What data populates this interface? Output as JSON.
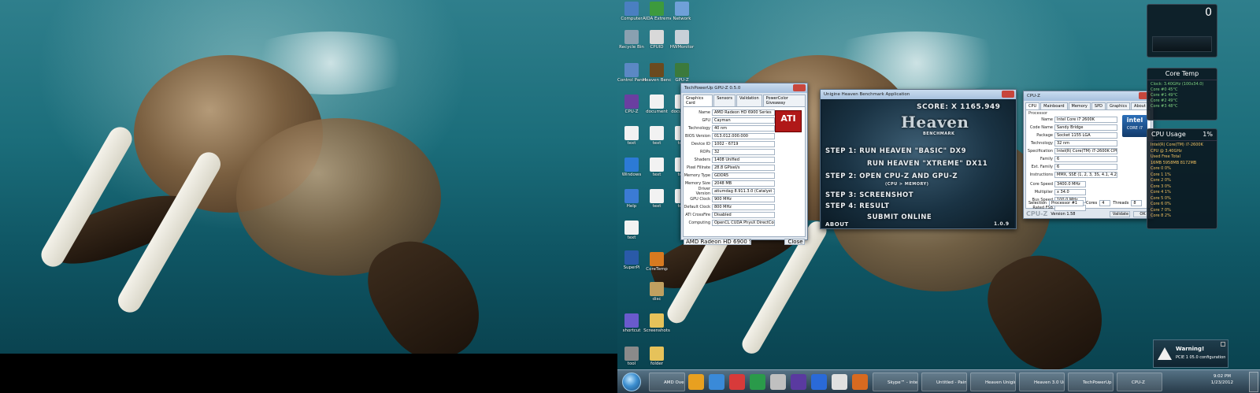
{
  "left_monitor": {},
  "desktop_icons": [
    {
      "label": "Computer",
      "color": "#4a7fc1"
    },
    {
      "label": "AIDA Extreme",
      "color": "#3d9a3d"
    },
    {
      "label": "Network",
      "color": "#6fa0d8"
    },
    {
      "label": "Recycle Bin",
      "color": "#8aa0b0"
    },
    {
      "label": "CPUID",
      "color": "#d9d9d9"
    },
    {
      "label": "HWMonitor",
      "color": "#c8d0d8"
    },
    {
      "label": "Control Panel",
      "color": "#5b88c4"
    },
    {
      "label": "Heaven Benchmark",
      "color": "#6b4a1e"
    },
    {
      "label": "GPU-Z",
      "color": "#3c7a3c"
    },
    {
      "label": "CPU-Z",
      "color": "#6a3fa0"
    },
    {
      "label": "document",
      "color": "#f2f2f2"
    },
    {
      "label": "document",
      "color": "#f2f2f2"
    },
    {
      "label": "text",
      "color": "#f2f2f2"
    },
    {
      "label": "text",
      "color": "#f2f2f2"
    },
    {
      "label": "text",
      "color": "#f2f2f2"
    },
    {
      "label": "Windows",
      "color": "#2c7ad6"
    },
    {
      "label": "text",
      "color": "#f2f2f2"
    },
    {
      "label": "text",
      "color": "#f2f2f2"
    },
    {
      "label": "Help",
      "color": "#3b7bd4"
    },
    {
      "label": "text",
      "color": "#f2f2f2"
    },
    {
      "label": "text",
      "color": "#f2f2f2"
    },
    {
      "label": "text",
      "color": "#f2f2f2"
    },
    {
      "label": "CoreTemp",
      "color": "#d87a20"
    },
    {
      "label": "SuperPi",
      "color": "#2a5aa8"
    },
    {
      "label": "disc",
      "color": "#c0a060"
    },
    {
      "label": "shortcut",
      "color": "#6a5acd"
    },
    {
      "label": "Screenshots",
      "color": "#e6c25a"
    },
    {
      "label": "tool",
      "color": "#8a8a8a"
    },
    {
      "label": "folder",
      "color": "#e6c25a"
    }
  ],
  "gpuz": {
    "title": "TechPowerUp GPU-Z 0.5.0",
    "tabs": [
      "Graphics Card",
      "Sensors",
      "Validation",
      "PowerColor Giveaway"
    ],
    "rows": [
      {
        "label": "Name",
        "value": "AMD Radeon HD 6900 Series"
      },
      {
        "label": "GPU",
        "value": "Cayman"
      },
      {
        "label": "Technology",
        "value": "40 nm"
      },
      {
        "label": "BIOS Version",
        "value": "013.012.000.000"
      },
      {
        "label": "Device ID",
        "value": "1002 - 6719"
      },
      {
        "label": "ROPs",
        "value": "32"
      },
      {
        "label": "Shaders",
        "value": "1408 Unified"
      },
      {
        "label": "Pixel Fillrate",
        "value": "28.8 GPixel/s"
      },
      {
        "label": "Memory Type",
        "value": "GDDR5"
      },
      {
        "label": "Memory Size",
        "value": "2048 MB"
      },
      {
        "label": "Driver Version",
        "value": "atiumdag 8.911.3.0 (Catalyst 11.10) / Win7 64"
      },
      {
        "label": "GPU Clock",
        "value": "900 MHz"
      },
      {
        "label": "Default Clock",
        "value": "800 MHz"
      },
      {
        "label": "ATI CrossFire",
        "value": "Disabled"
      },
      {
        "label": "Computing",
        "value": "OpenCL  CUDA  PhysX  DirectCompute 5.0"
      }
    ],
    "select_value": "AMD Radeon HD 6900 Series",
    "close_label": "Close",
    "logo_text": "ATI"
  },
  "heaven": {
    "title": "Unigine Heaven Benchmark Application",
    "score": "SCORE: X 1165.949",
    "logo": "Heaven",
    "logo_sub": "BENCHMARK",
    "step1": "STEP 1:  RUN HEAVEN \"BASIC\" DX9",
    "step1b": "RUN HEAVEN \"XTREME\" DX11",
    "step2": "STEP 2:  OPEN CPU-Z  AND  GPU-Z",
    "step2b": "(CPU > MEMORY)",
    "step3": "STEP 3:  SCREENSHOT",
    "step4": "STEP 4:  RESULT",
    "step4b": "SUBMIT ONLINE",
    "about": "ABOUT",
    "version": "1.0.9"
  },
  "cpuz": {
    "title": "CPU-Z",
    "tabs": [
      "CPU",
      "Mainboard",
      "Memory",
      "SPD",
      "Graphics",
      "About"
    ],
    "section_processor": "Processor",
    "rows": [
      {
        "label": "Name",
        "value": "Intel Core i7 2600K"
      },
      {
        "label": "Code Name",
        "value": "Sandy Bridge"
      },
      {
        "label": "Package",
        "value": "Socket 1155 LGA"
      },
      {
        "label": "Technology",
        "value": "32 nm"
      },
      {
        "label": "Specification",
        "value": "Intel(R) Core(TM) i7-2600K CPU @ 3.40GHz"
      },
      {
        "label": "Family",
        "value": "6"
      },
      {
        "label": "Ext. Family",
        "value": "6"
      },
      {
        "label": "Instructions",
        "value": "MMX, SSE (1, 2, 3, 3S, 4.1, 4.2), EM64T, VT-x, AES, AVX"
      }
    ],
    "clocks": [
      {
        "label": "Core Speed",
        "value": "3400.0 MHz"
      },
      {
        "label": "Multiplier",
        "value": "x 34.0"
      },
      {
        "label": "Bus Speed",
        "value": "100.0 MHz"
      },
      {
        "label": "Rated FSB",
        "value": ""
      }
    ],
    "selection_label": "Selection",
    "selection_value": "Processor #1",
    "cores_label": "Cores",
    "cores_value": "4",
    "threads_label": "Threads",
    "threads_value": "8",
    "brand": "CPU-Z",
    "version": "Version 1.58",
    "validate_label": "Validate",
    "ok_label": "OK",
    "intel_label": "intel",
    "intel_sub": "CORE i7"
  },
  "gadgets": {
    "clock_value": "0",
    "core_temp_title": "Core Temp",
    "core_temp_lines": [
      "Clock: 3.40GHz (100x34.0)",
      "Core #0  45°C",
      "Core #1  49°C",
      "Core #2  49°C",
      "Core #3  48°C"
    ],
    "cpu_usage_title": "CPU Usage",
    "cpu_usage_value": "1%",
    "cpu_usage_lines": [
      "Intel(R) Core(TM) i7-2600K",
      "CPU @ 3.40GHz",
      "Used   Free   Total",
      "16MB  5958MB  8172MB",
      "Core 0   0%",
      "Core 1   1%",
      "Core 2   0%",
      "Core 3   0%",
      "Core 4   1%",
      "Core 5   0%",
      "Core 6   0%",
      "Core 7   0%",
      "Core 8   2%"
    ]
  },
  "warning": {
    "title": "Warning!",
    "text": "PCIE 1 05.0 configuration"
  },
  "taskbar": {
    "buttons": [
      "AMD Overdrive",
      "",
      "",
      "",
      "",
      "",
      "",
      "",
      "",
      "",
      "Skype™ - intelg...",
      "Untitled - Paint.net",
      "Heaven Unigine...",
      "Heaven 3.0 Unigine...",
      "TechPowerUp G...",
      "CPU-Z"
    ],
    "clock_time": "9:02 PM",
    "clock_date": "1/23/2012"
  }
}
